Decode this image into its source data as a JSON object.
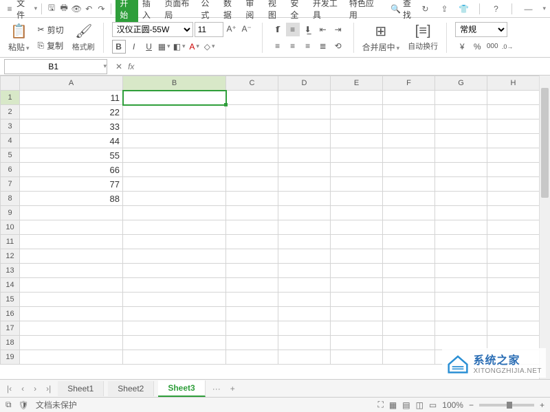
{
  "menu": {
    "file": "文件",
    "tabs": [
      "开始",
      "插入",
      "页面布局",
      "公式",
      "数据",
      "审阅",
      "视图",
      "安全",
      "开发工具",
      "特色应用"
    ],
    "active_tab": 0,
    "search": "查找"
  },
  "ribbon": {
    "paste": "粘贴",
    "cut": "剪切",
    "copy": "复制",
    "format_painter": "格式刷",
    "font_name": "汉仪正圆-55W",
    "font_size": "11",
    "merge": "合并居中",
    "wrap": "自动换行",
    "number_format": "常规"
  },
  "namebox": {
    "cell": "B1"
  },
  "columns": [
    "A",
    "B",
    "C",
    "D",
    "E",
    "F",
    "G",
    "H"
  ],
  "rows": [
    {
      "n": "1",
      "A": "11"
    },
    {
      "n": "2",
      "A": "22"
    },
    {
      "n": "3",
      "A": "33"
    },
    {
      "n": "4",
      "A": "44"
    },
    {
      "n": "5",
      "A": "55"
    },
    {
      "n": "6",
      "A": "66"
    },
    {
      "n": "7",
      "A": "77"
    },
    {
      "n": "8",
      "A": "88"
    },
    {
      "n": "9"
    },
    {
      "n": "10"
    },
    {
      "n": "11"
    },
    {
      "n": "12"
    },
    {
      "n": "13"
    },
    {
      "n": "14"
    },
    {
      "n": "15"
    },
    {
      "n": "16"
    },
    {
      "n": "17"
    },
    {
      "n": "18"
    },
    {
      "n": "19"
    }
  ],
  "sheets": {
    "list": [
      "Sheet1",
      "Sheet2",
      "Sheet3"
    ],
    "active": 2,
    "add": "+",
    "more": "···"
  },
  "status": {
    "protect": "文档未保护",
    "zoom": "100%"
  },
  "watermark": {
    "title": "系统之家",
    "url": "XITONGZHIJIA.NET"
  },
  "currency": "¥",
  "percent": "%"
}
